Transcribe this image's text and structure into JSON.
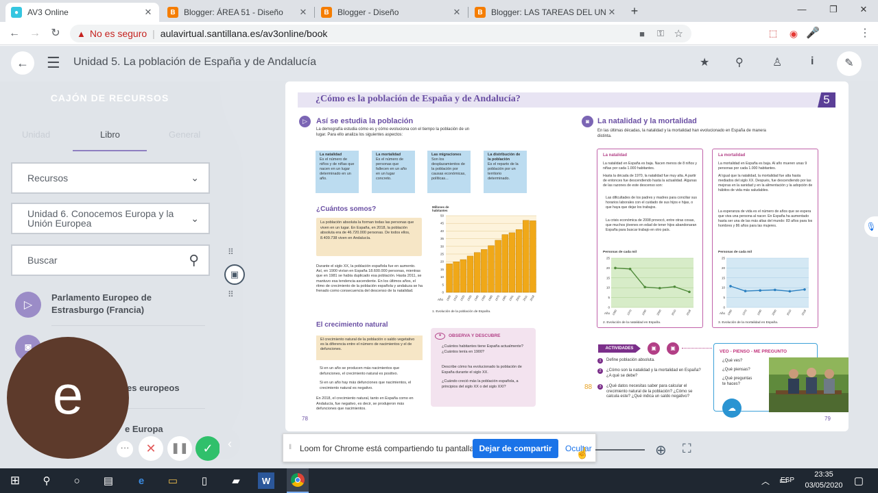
{
  "browser": {
    "tabs": [
      {
        "title": "AV3 Online",
        "icon": "app-icon",
        "color": "#35c6e0",
        "active": true
      },
      {
        "title": "Blogger: ÁREA 51 - Diseño",
        "icon": "blogger-icon",
        "color": "#f57d00"
      },
      {
        "title": "Blogger - Diseño",
        "icon": "blogger-icon",
        "color": "#f57d00"
      },
      {
        "title": "Blogger: LAS TAREAS DEL UNIVE",
        "icon": "blogger-icon",
        "color": "#f57d00"
      }
    ],
    "security_text": "No es seguro",
    "url": "aulavirtual.santillana.es/av3online/book",
    "profile_initial": "e"
  },
  "app": {
    "title": "Unidad 5. La población de España y de Andalucía"
  },
  "sidebar": {
    "heading": "CAJÓN DE RECURSOS",
    "tabs": [
      "Unidad",
      "Libro",
      "General"
    ],
    "active_tab": "Libro",
    "resources_select": "Recursos",
    "unit_select": "Unidad 6. Conocemos Europa y la Unión Europea",
    "search_placeholder": "Buscar",
    "items": [
      {
        "label": "Parlamento Europeo de Estrasburgo (Francia)",
        "icon": "play-icon"
      },
      {
        "label": "",
        "icon": "camera-icon"
      },
      {
        "label": "es europeos",
        "icon": ""
      },
      {
        "label": "e Europa",
        "icon": ""
      }
    ]
  },
  "webcam": {
    "initial": "e"
  },
  "book": {
    "unit_number": "5",
    "page_title": "¿Cómo es la población de España y de Andalucía?",
    "left": {
      "section1_title": "Así se estudia la población",
      "section1_intro": "La demografía estudia cómo es y cómo evoluciona con el tiempo la población de un lugar. Para ello analiza los siguientes aspectos:",
      "concepts": [
        {
          "title": "La natalidad",
          "text": "Es el número de niños y de niñas que nacen en un lugar determinado en un año."
        },
        {
          "title": "La mortalidad",
          "text": "Es el número de personas que fallecen en un año en un lugar concreto."
        },
        {
          "title": "Las migraciones",
          "text": "Son los desplazamientos de la población por causas económicas, políticas..."
        },
        {
          "title": "La distribución de la población",
          "text": "Es el reparto de la población por un territorio determinado."
        }
      ],
      "section2_title": "¿Cuántos somos?",
      "highlight_text": "La población absoluta la forman todas las personas que viven en un lugar. En España, en 2018, la población absoluta era de 46.720.000 personas. De todos ellos, 8.409.738 viven en Andalucía.",
      "paragraph": "Durante el siglo XX, la población española fue en aumento. Así, en 1900 vivían en España 18.600.000 personas, mientras que en 1981 se había duplicado esa población. Hasta 2011, se mantuvo esa tendencia ascendente. En los últimos años, el ritmo de crecimiento de la población española y andaluza se ha frenado como consecuencia del descenso de la natalidad.",
      "chart_ylabel": "Millones de habitantes",
      "chart_caption": "1. Evolución de la población de España.",
      "section3_title": "El crecimiento natural",
      "growth_box": "El crecimiento natural de la población o saldo vegetativo es la diferencia entre el número de nacimientos y el de defunciones.",
      "bullets": [
        "Si en un año se producen más nacimientos que defunciones, el crecimiento natural es positivo.",
        "Si en un año hay más defunciones que nacimientos, el crecimiento natural es negativo."
      ],
      "growth_para": "En 2018, el crecimiento natural, tanto en España como en Andalucía, fue negativo, es decir, se produjeron más defunciones que nacimientos.",
      "observe_title": "OBSERVA Y DESCUBRE",
      "observe_items": [
        "¿Cuántos habitantes tiene España actualmente? ¿Cuántos tenía en 1900?",
        "Describe cómo ha evolucionado la población de España durante el siglo XX.",
        "¿Cuándo creció más la población española, a principios del siglo XX o del siglo XXI?"
      ],
      "page_number": "78"
    },
    "right": {
      "section_title": "La natalidad y la mortalidad",
      "intro": "En las últimas décadas, la natalidad y la mortalidad han evolucionado en España de manera distinta.",
      "natalidad_title": "La natalidad",
      "mortalidad_title": "La mortalidad",
      "natalidad_points": [
        "La natalidad en España es baja. Nacen menos de 8 niños y niñas por cada 1.000 habitantes.",
        "Hasta la década de 1970, la natalidad fue muy alta. A partir de entonces fue descendiendo hasta la actualidad. Algunas de las razones de este descenso son:",
        "Las dificultades de los padres y madres para conciliar sus horarios laborales con el cuidado de sus hijos e hijas, o que haya que dejar los trabajos.",
        "La crisis económica de 2008 provocó, entre otras cosas, que muchos jóvenes en edad de tener hijos abandonaran España para buscar trabajo en otro país."
      ],
      "mortalidad_points": [
        "La mortalidad en España es baja. Al año mueren unas 9 personas por cada 1.000 habitantes.",
        "Al igual que la natalidad, la mortalidad fue alta hasta mediados del siglo XX. Después, fue descendiendo por las mejoras en la sanidad y en la alimentación y la adopción de hábitos de vida más saludables.",
        "La esperanza de vida es el número de años que se espera que viva una persona al nacer. En España ha aumentado hasta ser una de las más altas del mundo: 83 años para los hombres y 86 años para las mujeres."
      ],
      "chart_ylabel": "Personas de cada mil",
      "natalidad_caption": "2. Evolución de la natalidad en España.",
      "mortalidad_caption": "3. Evolución de la mortalidad en España.",
      "activities_label": "ACTIVIDADES",
      "activities": [
        "Define población absoluta.",
        "¿Cómo son la natalidad y la mortalidad en España? ¿A qué se debe?",
        "¿Qué datos necesitas saber para calcular el crecimiento natural de la población? ¿Cómo se calcula este? ¿Qué indica un saldo negativo?"
      ],
      "activity_numbers": [
        "1",
        "2",
        "3"
      ],
      "side_number": "88",
      "veo_title": "VEO - PIENSO - ME PREGUNTO",
      "veo_items": [
        "¿Qué ves?",
        "¿Qué piensas?",
        "¿Qué preguntas te haces?"
      ],
      "page_number": "79"
    }
  },
  "loom": {
    "message": "Loom for Chrome está compartiendo tu pantalla.",
    "stop_label": "Dejar de compartir",
    "hide_label": "Ocultar"
  },
  "taskbar": {
    "lang": "ESP",
    "time": "23:35",
    "date": "03/05/2020"
  },
  "chart_data": [
    {
      "type": "bar",
      "title": "",
      "ylabel": "Millones de habitantes",
      "xlabel": "Año",
      "categories": [
        "1900",
        "1910",
        "1920",
        "1930",
        "1940",
        "1950",
        "1960",
        "1970",
        "1981",
        "1991",
        "2001",
        "2011",
        "2018"
      ],
      "values": [
        18.6,
        20,
        21.4,
        23.7,
        26,
        28,
        30.5,
        34,
        37.7,
        38.9,
        41,
        47,
        46.7
      ],
      "ylim": [
        0,
        50
      ]
    },
    {
      "type": "line",
      "title": "La natalidad",
      "ylabel": "Personas de cada mil",
      "xlabel": "Año",
      "x": [
        "1950",
        "1970",
        "1990",
        "2000",
        "2010",
        "2018"
      ],
      "values": [
        20,
        19.5,
        10.3,
        9.8,
        10.5,
        7.9
      ],
      "ylim": [
        0,
        25
      ]
    },
    {
      "type": "line",
      "title": "La mortalidad",
      "ylabel": "Personas de cada mil",
      "xlabel": "Año",
      "x": [
        "1950",
        "1970",
        "1990",
        "2000",
        "2010",
        "2018"
      ],
      "values": [
        10.8,
        8.3,
        8.6,
        8.9,
        8.2,
        9.1
      ],
      "ylim": [
        0,
        25
      ]
    }
  ]
}
